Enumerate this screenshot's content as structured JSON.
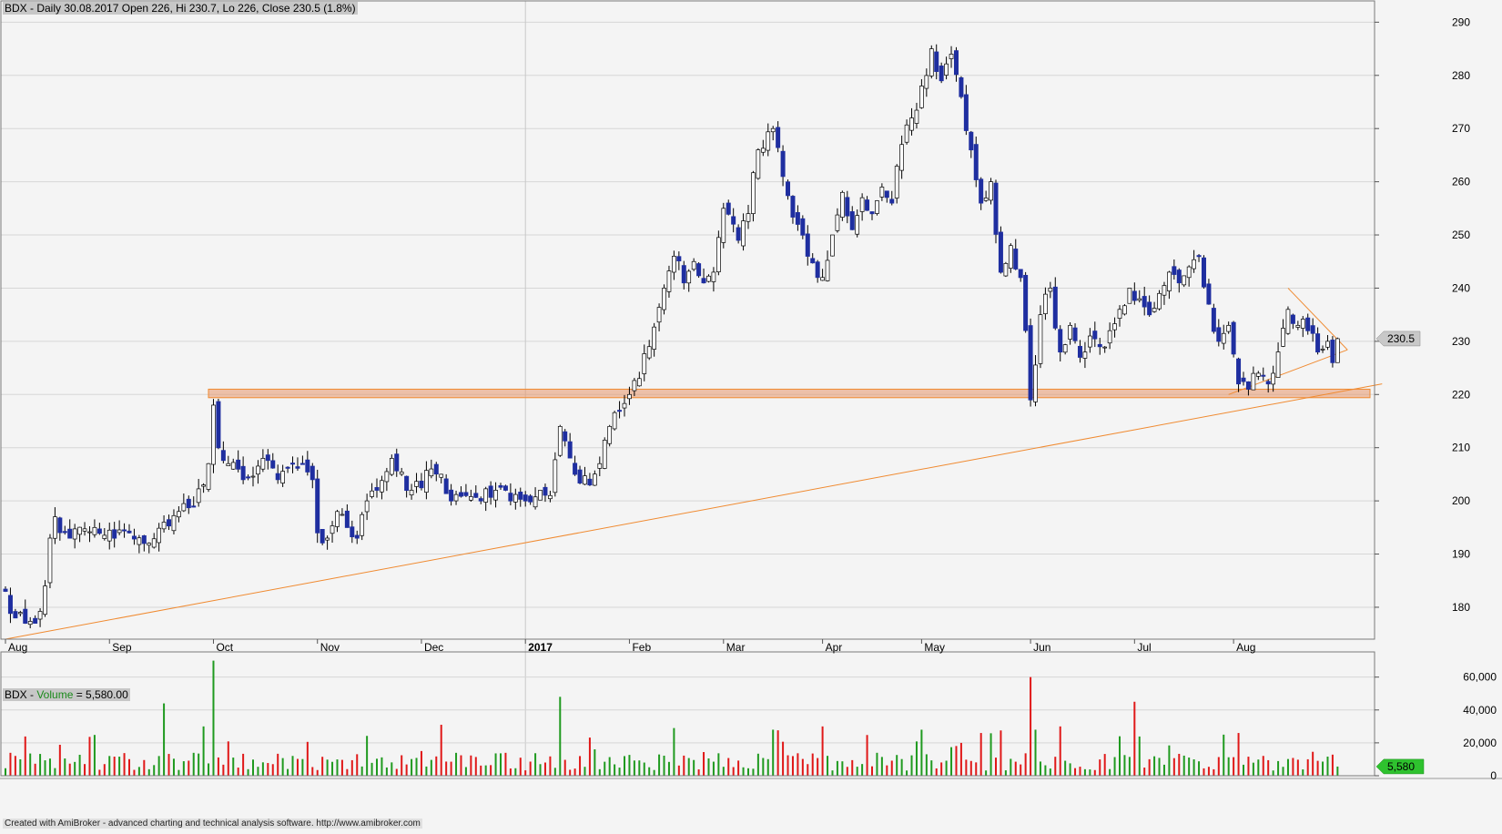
{
  "window": {
    "price_header": "BDX - Daily 30.08.2017 Open 226, Hi 230.7, Lo 226, Close 230.5 (1.8%)",
    "volume_header_prefix": "BDX - ",
    "volume_header_name": "Volume",
    "volume_header_value": " = 5,580.00",
    "footer": "Created with AmiBroker - advanced charting and technical analysis software. http://www.amibroker.com"
  },
  "colors": {
    "background": "#f4f4f4",
    "up_candle_fill": "#ffffff",
    "down_candle_fill": "#1f2ea0",
    "candle_outline": "#000000",
    "volume_up": "#1f9a1f",
    "volume_down": "#e01818",
    "trendline": "#f08a30",
    "support_band": "#e8956a",
    "last_price_badge": "#c8c8c8",
    "last_volume_badge": "#2ec22e"
  },
  "chart_data": [
    {
      "type": "candlestick",
      "symbol": "BDX",
      "title": "BDX - Daily 30.08.2017 Open 226, Hi 230.7, Lo 226, Close 230.5 (1.8%)",
      "ylim": [
        174,
        294
      ],
      "y_ticks": [
        180,
        190,
        200,
        210,
        220,
        230,
        240,
        250,
        260,
        270,
        280,
        290
      ],
      "x_tick_labels": [
        "Aug",
        "Sep",
        "Oct",
        "Nov",
        "Dec",
        "2017",
        "Feb",
        "Mar",
        "Apr",
        "May",
        "Jun",
        "Jul",
        "Aug"
      ],
      "x_tick_bar_index": [
        0,
        21,
        42,
        63,
        84,
        105,
        126,
        145,
        165,
        185,
        207,
        228,
        248
      ],
      "last_close": 230.5,
      "last_close_label": "230.5",
      "grid": true,
      "support_zone": {
        "low": 219.4,
        "high": 221.0
      },
      "annotations": [
        {
          "kind": "trendline",
          "from": {
            "bar": 0,
            "price": 174.0
          },
          "to": {
            "bar": 278,
            "price": 222.0
          }
        },
        {
          "kind": "triangle_upper",
          "from": {
            "bar": 259,
            "price": 240.0
          },
          "to": {
            "bar": 271,
            "price": 228.4
          }
        },
        {
          "kind": "triangle_lower",
          "from": {
            "bar": 247,
            "price": 220.0
          },
          "to": {
            "bar": 271,
            "price": 228.4
          }
        }
      ],
      "anchors": [
        [
          0,
          183
        ],
        [
          2,
          178
        ],
        [
          4,
          177
        ],
        [
          6,
          177
        ],
        [
          8,
          184
        ],
        [
          9,
          193
        ],
        [
          10,
          197
        ],
        [
          13,
          193
        ],
        [
          18,
          195
        ],
        [
          22,
          193
        ],
        [
          25,
          194
        ],
        [
          28,
          192
        ],
        [
          32,
          196
        ],
        [
          35,
          198
        ],
        [
          38,
          199
        ],
        [
          40,
          203
        ],
        [
          41,
          207
        ],
        [
          42,
          218
        ],
        [
          43,
          210
        ],
        [
          45,
          207
        ],
        [
          48,
          204
        ],
        [
          52,
          208
        ],
        [
          55,
          204
        ],
        [
          58,
          207
        ],
        [
          60,
          207
        ],
        [
          62,
          204
        ],
        [
          63,
          194
        ],
        [
          65,
          193
        ],
        [
          67,
          198
        ],
        [
          69,
          195
        ],
        [
          71,
          193
        ],
        [
          73,
          200
        ],
        [
          75,
          202
        ],
        [
          78,
          208
        ],
        [
          82,
          202
        ],
        [
          86,
          206
        ],
        [
          88,
          205
        ],
        [
          90,
          200
        ],
        [
          93,
          201
        ],
        [
          96,
          200
        ],
        [
          99,
          202
        ],
        [
          102,
          200
        ],
        [
          105,
          200
        ],
        [
          108,
          202
        ],
        [
          110,
          201
        ],
        [
          112,
          214
        ],
        [
          115,
          205
        ],
        [
          118,
          203
        ],
        [
          120,
          207
        ],
        [
          122,
          214
        ],
        [
          124,
          217
        ],
        [
          126,
          220
        ],
        [
          128,
          223
        ],
        [
          130,
          229
        ],
        [
          133,
          240
        ],
        [
          135,
          246
        ],
        [
          137,
          241
        ],
        [
          139,
          245
        ],
        [
          141,
          241
        ],
        [
          143,
          243
        ],
        [
          145,
          255
        ],
        [
          148,
          249
        ],
        [
          150,
          254
        ],
        [
          152,
          266
        ],
        [
          155,
          270
        ],
        [
          157,
          261
        ],
        [
          160,
          252
        ],
        [
          162,
          246
        ],
        [
          165,
          242
        ],
        [
          167,
          250
        ],
        [
          169,
          258
        ],
        [
          171,
          251
        ],
        [
          173,
          257
        ],
        [
          175,
          254
        ],
        [
          177,
          259
        ],
        [
          179,
          256
        ],
        [
          181,
          267
        ],
        [
          183,
          272
        ],
        [
          185,
          278
        ],
        [
          187,
          285
        ],
        [
          189,
          279
        ],
        [
          191,
          284
        ],
        [
          193,
          276
        ],
        [
          195,
          266
        ],
        [
          197,
          256
        ],
        [
          199,
          260
        ],
        [
          201,
          243
        ],
        [
          203,
          248
        ],
        [
          205,
          242
        ],
        [
          207,
          219
        ],
        [
          209,
          235
        ],
        [
          211,
          240
        ],
        [
          213,
          228
        ],
        [
          215,
          233
        ],
        [
          217,
          227
        ],
        [
          219,
          231
        ],
        [
          221,
          229
        ],
        [
          223,
          232
        ],
        [
          225,
          236
        ],
        [
          227,
          240
        ],
        [
          229,
          238
        ],
        [
          231,
          235
        ],
        [
          233,
          239
        ],
        [
          235,
          243
        ],
        [
          237,
          241
        ],
        [
          239,
          244
        ],
        [
          241,
          246
        ],
        [
          243,
          237
        ],
        [
          245,
          230
        ],
        [
          247,
          233
        ],
        [
          249,
          222
        ],
        [
          251,
          221
        ],
        [
          253,
          224
        ],
        [
          255,
          222
        ],
        [
          257,
          228
        ],
        [
          259,
          236
        ],
        [
          261,
          233
        ],
        [
          263,
          232
        ],
        [
          265,
          228
        ],
        [
          267,
          230
        ],
        [
          268,
          226
        ],
        [
          269,
          230.5
        ]
      ],
      "seed": 1847
    },
    {
      "type": "bar",
      "title": "BDX - Volume = 5,580.00",
      "series": [
        {
          "name": "Volume"
        }
      ],
      "ylim": [
        0,
        72000
      ],
      "y_ticks": [
        0,
        20000,
        40000,
        60000
      ],
      "y_tick_labels": [
        "0",
        "20,000",
        "40,000",
        "60,000"
      ],
      "last_value": 5580,
      "last_value_label": "5,580",
      "bar_count": 270,
      "base_volume": 9000,
      "spikes": [
        [
          42,
          70000
        ],
        [
          32,
          44000
        ],
        [
          40,
          30000
        ],
        [
          88,
          31000
        ],
        [
          112,
          48000
        ],
        [
          135,
          29000
        ],
        [
          207,
          60000
        ],
        [
          228,
          45000
        ],
        [
          155,
          28000
        ],
        [
          165,
          30000
        ],
        [
          185,
          28000
        ],
        [
          197,
          26000
        ],
        [
          208,
          28000
        ],
        [
          213,
          30000
        ],
        [
          225,
          24000
        ],
        [
          246,
          25000
        ],
        [
          249,
          26000
        ]
      ]
    }
  ]
}
